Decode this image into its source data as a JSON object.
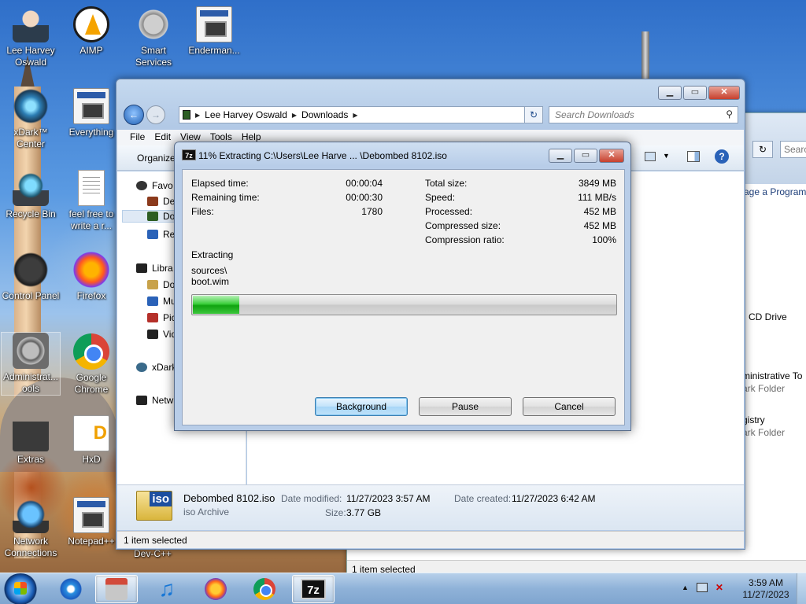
{
  "desktop": {
    "icons": [
      {
        "label": "Lee Harvey Oswald",
        "icon": "user-folder-icon"
      },
      {
        "label": "AIMP",
        "icon": "aimp-icon"
      },
      {
        "label": "Smart Services",
        "icon": "gear-icon"
      },
      {
        "label": "Enderman...",
        "icon": "window-icon"
      },
      {
        "label": "xDark™ Center",
        "icon": "orb-icon"
      },
      {
        "label": "Everything",
        "icon": "search-app-icon"
      },
      {
        "label": "Recycle Bin",
        "icon": "recycle-bin-icon"
      },
      {
        "label": "feel free to write a r...",
        "icon": "text-file-icon"
      },
      {
        "label": "Control Panel",
        "icon": "control-panel-icon"
      },
      {
        "label": "Firefox",
        "icon": "firefox-icon"
      },
      {
        "label": "Administrat... ools",
        "icon": "admin-tools-icon"
      },
      {
        "label": "Google Chrome",
        "icon": "chrome-icon"
      },
      {
        "label": "Extras",
        "icon": "folder-icon"
      },
      {
        "label": "HxD",
        "icon": "hxd-icon"
      },
      {
        "label": "Network Connections",
        "icon": "network-icon"
      },
      {
        "label": "Notepad++",
        "icon": "notepadpp-icon"
      },
      {
        "label": "Dev-C++",
        "icon": "devcpp-icon"
      }
    ]
  },
  "back_window": {
    "search_placeholder": "Searc",
    "refresh_symbol": "↻",
    "link_uninstall": "age a Program",
    "cd_drive": "CD Drive",
    "admin_tools": "ministrative To",
    "admin_tools_sub": "ark Folder",
    "registry": "gistry",
    "registry_sub": "ark Folder",
    "status": "1 item selected"
  },
  "explorer": {
    "window_buttons": {
      "minimize": "▁",
      "maximize": "▭",
      "close": "✕"
    },
    "back_symbol": "←",
    "forward_symbol": "→",
    "breadcrumb": [
      "Lee Harvey Oswald",
      "Downloads"
    ],
    "breadcrumb_arrow": "▶",
    "dropdown_symbol": "▼",
    "refresh_symbol": "↻",
    "search_placeholder": "Search Downloads",
    "search_symbol": "⚲",
    "menu": [
      "File",
      "Edit",
      "View",
      "Tools",
      "Help"
    ],
    "organize": "Organize",
    "help_symbol": "?",
    "nav": [
      {
        "label": "Favo",
        "icon": "star-icon",
        "color": "#333333"
      },
      {
        "label": "Des",
        "icon": "desktop-icon",
        "color": "#8b3a1c"
      },
      {
        "label": "Do",
        "icon": "downloads-icon",
        "color": "#2d5d23"
      },
      {
        "label": "Rec",
        "icon": "recent-places-icon",
        "color": "#2a62b8"
      },
      {
        "label": "Libra",
        "icon": "libraries-icon",
        "color": "#222222"
      },
      {
        "label": "Do",
        "icon": "documents-icon",
        "color": "#c8a24a"
      },
      {
        "label": "Mu",
        "icon": "music-icon",
        "color": "#2a62b8"
      },
      {
        "label": "Pic",
        "icon": "pictures-icon",
        "color": "#b5302a"
      },
      {
        "label": "Vid",
        "icon": "videos-icon",
        "color": "#222222"
      },
      {
        "label": "xDark",
        "icon": "xdark-icon",
        "color": "#3a6a8a"
      },
      {
        "label": "Netw",
        "icon": "network-icon",
        "color": "#222222"
      }
    ],
    "details": {
      "badge": "iso",
      "name": "Debombed 8102.iso",
      "type": "iso Archive",
      "modified_label": "Date modified:",
      "modified_value": "11/27/2023 3:57 AM",
      "created_label": "Date created:",
      "created_value": "11/27/2023 6:42 AM",
      "size_label": "Size:",
      "size_value": "3.77 GB"
    },
    "status": "1 item selected"
  },
  "dialog": {
    "app_badge": "7z",
    "title": "11% Extracting C:\\Users\\Lee Harve ... \\Debombed 8102.iso",
    "window_buttons": {
      "minimize": "▁",
      "maximize": "▭",
      "close": "✕"
    },
    "stats_left": [
      {
        "label": "Elapsed time:",
        "value": "00:00:04"
      },
      {
        "label": "Remaining time:",
        "value": "00:00:30"
      },
      {
        "label": "Files:",
        "value": "1780"
      }
    ],
    "stats_right": [
      {
        "label": "Total size:",
        "value": "3849 MB"
      },
      {
        "label": "Speed:",
        "value": "111 MB/s"
      },
      {
        "label": "Processed:",
        "value": "452 MB"
      },
      {
        "label": "Compressed size:",
        "value": "452 MB"
      },
      {
        "label": "Compression ratio:",
        "value": "100%"
      }
    ],
    "status_label": "Extracting",
    "current_path": "sources\\",
    "current_file": "boot.wim",
    "progress": 0.11,
    "buttons": {
      "background": "Background",
      "pause": "Pause",
      "cancel": "Cancel"
    }
  },
  "taskbar": {
    "apps": [
      {
        "name": "internet-explorer",
        "icon": "ie-icon",
        "active": false
      },
      {
        "name": "app",
        "icon": "app-icon",
        "active": true
      },
      {
        "name": "music-player",
        "icon": "music-note-icon",
        "active": false
      },
      {
        "name": "firefox",
        "icon": "firefox-icon",
        "active": false
      },
      {
        "name": "chrome",
        "icon": "chrome-icon",
        "active": false
      },
      {
        "name": "7-zip",
        "icon": "7zip-icon",
        "active": true
      }
    ],
    "note_glyph": "♫",
    "sevenzip_label": "7z",
    "tray_arrow": "▲",
    "speaker_glyph": "✕",
    "time": "3:59 AM",
    "date": "11/27/2023"
  }
}
